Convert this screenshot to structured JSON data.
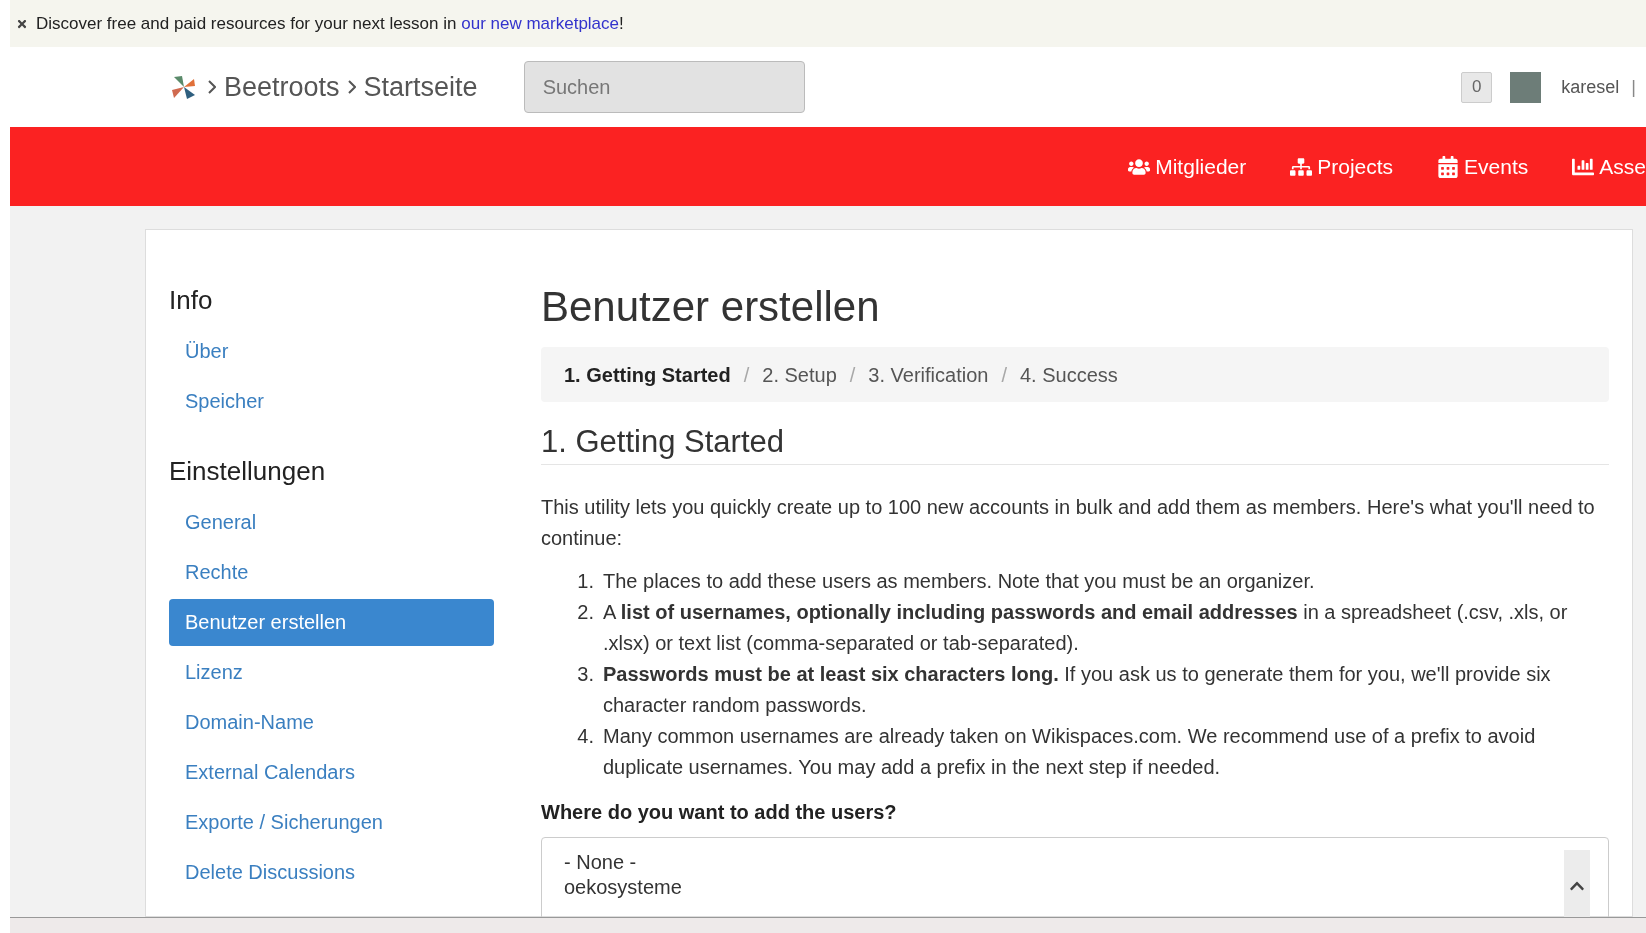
{
  "banner": {
    "text": "Discover free and paid resources for your next lesson in ",
    "link": "our new marketplace",
    "suffix": "!"
  },
  "header": {
    "crumbs": [
      "Beetroots",
      "Startseite"
    ],
    "search": {
      "placeholder": "Suchen"
    },
    "notifications": "0",
    "username": "karesel",
    "separator": "|"
  },
  "nav": [
    {
      "kind": "users",
      "label": "Mitglieder"
    },
    {
      "kind": "sitemap",
      "label": "Projects"
    },
    {
      "kind": "calendar",
      "label": "Events"
    },
    {
      "kind": "chart",
      "label": "Asse"
    }
  ],
  "sidebar": [
    {
      "title": "Info",
      "items": [
        {
          "label": "Über",
          "selected": false
        },
        {
          "label": "Speicher",
          "selected": false
        }
      ]
    },
    {
      "title": "Einstellungen",
      "items": [
        {
          "label": "General",
          "selected": false
        },
        {
          "label": "Rechte",
          "selected": false
        },
        {
          "label": "Benutzer erstellen",
          "selected": true
        },
        {
          "label": "Lizenz",
          "selected": false
        },
        {
          "label": "Domain-Name",
          "selected": false
        },
        {
          "label": "External Calendars",
          "selected": false
        },
        {
          "label": "Exporte / Sicherungen",
          "selected": false
        },
        {
          "label": "Delete Discussions",
          "selected": false
        }
      ]
    }
  ],
  "main": {
    "title": "Benutzer erstellen",
    "steps": [
      {
        "label": "1. Getting Started",
        "selected": true
      },
      {
        "label": "2. Setup",
        "selected": false
      },
      {
        "label": "3. Verification",
        "selected": false
      },
      {
        "label": "4. Success",
        "selected": false
      }
    ],
    "step_separator": "/",
    "heading": "1. Getting Started",
    "intro": "This utility lets you quickly create up to 100 new accounts in bulk and add them as members. Here's what you'll need to continue:",
    "list": [
      {
        "number": "1.",
        "text": "The places to add these users as members. Note that you must be an organizer."
      },
      {
        "number": "2.",
        "text": "A **list of usernames, optionally including passwords and email addresses** in a spreadsheet (.csv, .xls, or .xlsx) or text list (comma-separated or tab-separated)."
      },
      {
        "number": "3.",
        "text": "**Passwords must be at least six characters long.** If you ask us to generate them for you, we'll provide six character random passwords."
      },
      {
        "number": "4.",
        "text": "Many common usernames are already taken on Wikispaces.com. We recommend use of a prefix to avoid duplicate usernames. You may add a prefix in the next step if needed."
      }
    ],
    "question": "Where do you want to add the users?",
    "options": [
      "- None -",
      "oekosysteme"
    ]
  }
}
